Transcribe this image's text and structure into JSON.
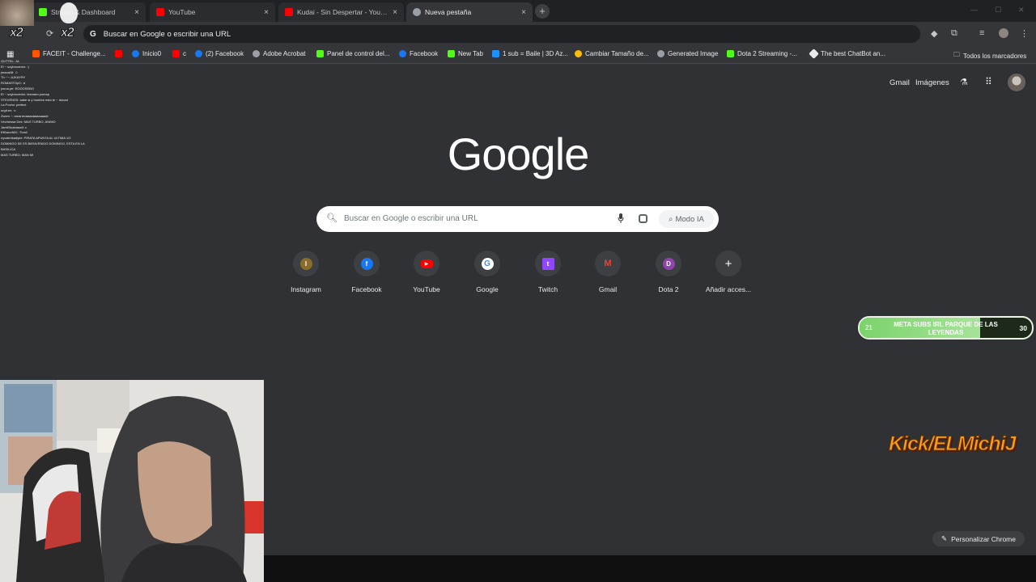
{
  "browser": {
    "tabs": [
      {
        "label": "Stream & Dashboard",
        "favicon_color": "#53fc18",
        "state": "inactive"
      },
      {
        "label": "YouTube",
        "favicon_color": "#ff0000",
        "state": "inactive"
      },
      {
        "label": "Kudai - Sin Despertar - YouTube",
        "favicon_color": "#ff0000",
        "state": "inactive"
      },
      {
        "label": "Nueva pestaña",
        "favicon_color": "#9aa0a6",
        "state": "active"
      }
    ],
    "new_tab_glyph": "+",
    "close_glyph": "×",
    "omnibox": {
      "icon": "G",
      "text": "Buscar en Google o escribir una URL"
    },
    "bookmarks": [
      {
        "label": "FACEIT - Challenge...",
        "icon_color": "#ff5500"
      },
      {
        "label": "",
        "icon_color": "#ff0000"
      },
      {
        "label": "Inicio0",
        "icon_color": "#1877f2"
      },
      {
        "label": "c",
        "icon_color": "#ff0000"
      },
      {
        "label": "(2) Facebook",
        "icon_color": "#1877f2"
      },
      {
        "label": "Adobe Acrobat",
        "icon_color": "#9aa0a6"
      },
      {
        "label": "Panel de control del...",
        "icon_color": "#53fc18"
      },
      {
        "label": "Facebook",
        "icon_color": "#1877f2"
      },
      {
        "label": "New Tab",
        "icon_color": "#53fc18"
      },
      {
        "label": "1 sub = Baile | 3D Az...",
        "icon_color": "#1e90ff"
      },
      {
        "label": "Cambiar Tamaño de...",
        "icon_color": "#fbbc05"
      },
      {
        "label": "Generated Image",
        "icon_color": "#9aa0a6"
      },
      {
        "label": "Dota 2 Streaming -...",
        "icon_color": "#53fc18"
      },
      {
        "label": "The best ChatBot an...",
        "icon_color": "#e8eaed"
      }
    ],
    "all_bookmarks": "Todos los marcadores"
  },
  "header": {
    "gmail": "Gmail",
    "images": "Imágenes"
  },
  "logo": "Google",
  "search": {
    "placeholder": "Buscar en Google o escribir una URL",
    "ai_mode": "Modo IA"
  },
  "shortcuts": [
    {
      "label": "Instagram",
      "letter": "I",
      "color": "#8a6d2b"
    },
    {
      "label": "Facebook",
      "letter": "f",
      "color": "#1877f2"
    },
    {
      "label": "YouTube",
      "letter": "▶",
      "color": "#ff0000"
    },
    {
      "label": "Google",
      "letter": "G",
      "color": "#ffffff"
    },
    {
      "label": "Twitch",
      "letter": "t",
      "color": "#9146ff"
    },
    {
      "label": "Gmail",
      "letter": "M",
      "color": "#ea4335"
    },
    {
      "label": "Dota 2",
      "letter": "D",
      "color": "#8e44ad"
    },
    {
      "label": "Añadir acces...",
      "letter": "+",
      "color": "#3c4043"
    }
  ],
  "overlay": {
    "goal_current": "21",
    "goal_title": "META SUBS IRL PARQUE DE LAS LEYENDAS",
    "goal_target": "30",
    "goal_progress": 0.7,
    "kick_text": "Kick/ELMichiJ",
    "x2_label": "x2"
  },
  "customize": "Personalizar Chrome",
  "chat_lines": [
    "GUTTEL: JA",
    "El ~ soybrozedro: :)",
    "jmaca08: ☺",
    "Th ~~: AJKAYRY",
    "ROMASTOp0: :d",
    "jonna.pe: ROOOSEBO",
    "El ~ soybrozedro: texmam pomap",
    "STEVENSS: sabe si y hombre esto te ~ donad",
    "La Pocho: perfect",
    "orgit.ex: :v",
    "Zwom ~: amanecaaaaaaaaaaaa!",
    "Vinchessa Dez: MAS TURBO, ANIMO",
    "JamilSuaidaseil: c",
    "ElKlacoNiX: :Tomi!",
    "nyvalerikadipie: PIRATA APUNTA AL ULTIMA 1/2",
    "DOMINGO SE ES BIENVENIDO DOMINGO, ESTA EN LA",
    "BASILICA",
    "MAS TURBO, MAN MI"
  ]
}
